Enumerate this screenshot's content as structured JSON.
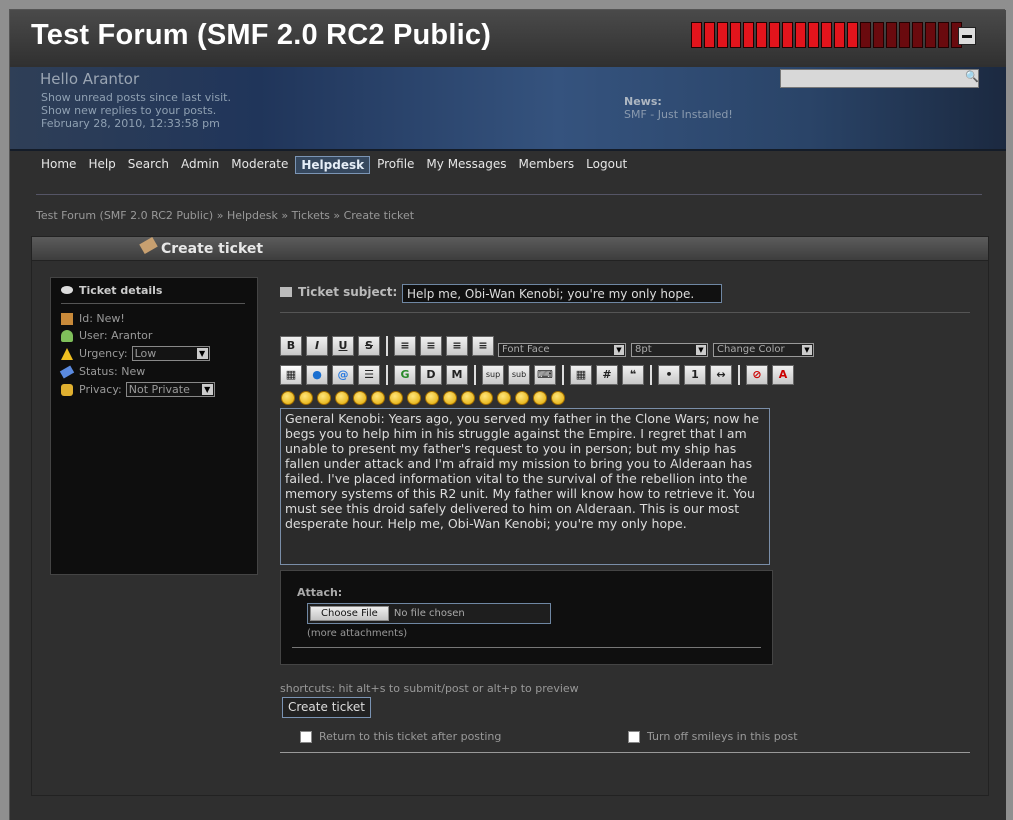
{
  "header": {
    "forum_title": "Test Forum (SMF 2.0 RC2 Public)",
    "meter": {
      "lit": 13,
      "total": 21,
      "on_color": "#e3141c",
      "off_color": "#6a0a0e"
    }
  },
  "user": {
    "greeting": "Hello Arantor",
    "unread_posts": "Show unread posts since last visit.",
    "new_replies": "Show new replies to your posts.",
    "datetime": "February 28, 2010, 12:33:58 pm"
  },
  "news": {
    "label": "News:",
    "text": "SMF - Just Installed!"
  },
  "menu": {
    "items": [
      {
        "label": "Home"
      },
      {
        "label": "Help"
      },
      {
        "label": "Search"
      },
      {
        "label": "Admin"
      },
      {
        "label": "Moderate"
      },
      {
        "label": "Helpdesk",
        "active": true
      },
      {
        "label": "Profile"
      },
      {
        "label": "My Messages"
      },
      {
        "label": "Members"
      },
      {
        "label": "Logout"
      }
    ]
  },
  "breadcrumb": "Test Forum (SMF 2.0 RC2 Public) » Helpdesk » Tickets » Create ticket",
  "page_title": "Create ticket",
  "ticket_details": {
    "heading": "Ticket details",
    "id": "Id: New!",
    "user": "User: Arantor",
    "urgency_label": "Urgency:",
    "urgency_value": "Low",
    "status": "Status: New",
    "privacy_label": "Privacy:",
    "privacy_value": "Not Private"
  },
  "form": {
    "subject_label": "Ticket subject:",
    "subject_value": "Help me, Obi-Wan Kenobi; you're my only hope.",
    "font_face": "Font Face",
    "font_size": "8pt",
    "font_color": "Change Color",
    "message": "General Kenobi: Years ago, you served my father in the Clone Wars; now he begs you to help him in his struggle against the Empire. I regret that I am unable to present my father's request to you in person; but my ship has fallen under attack and I'm afraid my mission to bring you to Alderaan has failed. I've placed information vital to the survival of the rebellion into the memory systems of this R2 unit. My father will know how to retrieve it. You must see this droid safely delivered to him on Alderaan. This is our most desperate hour. Help me, Obi-Wan Kenobi; you're my only hope.",
    "attach_label": "Attach:",
    "choose_file": "Choose File",
    "no_file": "No file chosen",
    "more_attachments": "(more attachments)",
    "shortcuts": "shortcuts: hit alt+s to submit/post or alt+p to preview",
    "submit": "Create ticket",
    "return_option": "Return to this ticket after posting",
    "smileys_option": "Turn off smileys in this post"
  },
  "toolbar": {
    "row1": [
      "B",
      "I",
      "U",
      "S"
    ],
    "row2_glyphs": [
      "G",
      "D",
      "M",
      "sup",
      "sub",
      "#",
      "A"
    ]
  }
}
